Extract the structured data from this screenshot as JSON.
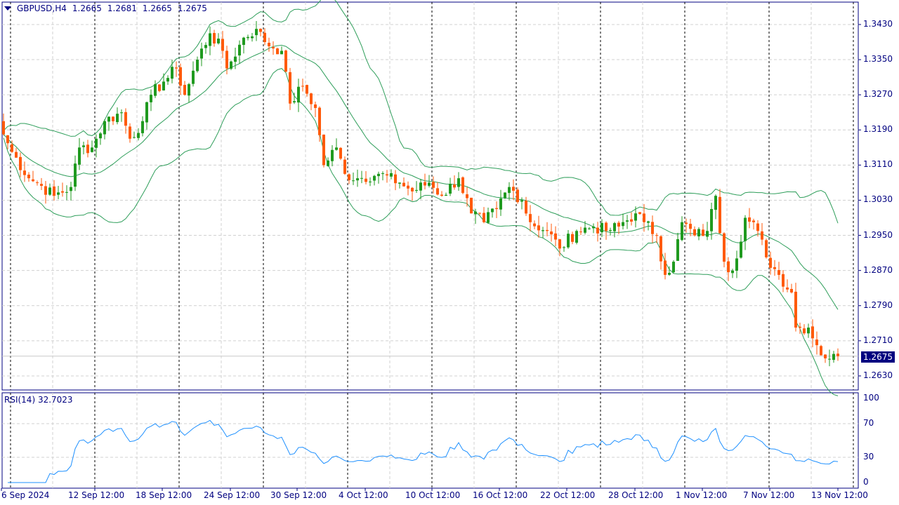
{
  "header": {
    "symbol": "GBPUSD,H4",
    "open": "1.2665",
    "high": "1.2681",
    "low": "1.2665",
    "close": "1.2675"
  },
  "current_price": "1.2675",
  "rsi": {
    "label": "RSI(14) 32.7023",
    "levels": [
      "100",
      "70",
      "30",
      "0"
    ]
  },
  "colors": {
    "bull": "#1f9a1f",
    "bear": "#ff5a0a",
    "band": "#2e9e5a",
    "rsi": "#1e90ff",
    "axis": "#000080",
    "grid": "#d0d0d0"
  },
  "chart_data": {
    "type": "candlestick",
    "title": "GBPUSD,H4",
    "price_ticks": [
      "1.3430",
      "1.3350",
      "1.3270",
      "1.3190",
      "1.3110",
      "1.3030",
      "1.2950",
      "1.2870",
      "1.2790",
      "1.2710",
      "1.2630"
    ],
    "ylim": [
      1.2598,
      1.3481
    ],
    "time_labels": [
      "6 Sep 2024",
      "12 Sep 12:00",
      "18 Sep 12:00",
      "24 Sep 12:00",
      "30 Sep 12:00",
      "4 Oct 12:00",
      "10 Oct 12:00",
      "16 Oct 12:00",
      "22 Oct 12:00",
      "28 Oct 12:00",
      "1 Nov 12:00",
      "7 Nov 12:00",
      "13 Nov 12:00"
    ],
    "bar_count": 199,
    "close_waypoints": [
      [
        0,
        1.318
      ],
      [
        2,
        1.314
      ],
      [
        6,
        1.308
      ],
      [
        8,
        1.307
      ],
      [
        12,
        1.304
      ],
      [
        16,
        1.306
      ],
      [
        18,
        1.315
      ],
      [
        21,
        1.315
      ],
      [
        24,
        1.321
      ],
      [
        28,
        1.323
      ],
      [
        30,
        1.317
      ],
      [
        33,
        1.321
      ],
      [
        35,
        1.327
      ],
      [
        38,
        1.33
      ],
      [
        41,
        1.333
      ],
      [
        43,
        1.327
      ],
      [
        46,
        1.335
      ],
      [
        49,
        1.341
      ],
      [
        52,
        1.337
      ],
      [
        53,
        1.333
      ],
      [
        57,
        1.34
      ],
      [
        60,
        1.342
      ],
      [
        62,
        1.339
      ],
      [
        66,
        1.337
      ],
      [
        68,
        1.325
      ],
      [
        71,
        1.329
      ],
      [
        74,
        1.324
      ],
      [
        76,
        1.311
      ],
      [
        79,
        1.315
      ],
      [
        81,
        1.309
      ],
      [
        84,
        1.308
      ],
      [
        89,
        1.309
      ],
      [
        94,
        1.307
      ],
      [
        97,
        1.305
      ],
      [
        101,
        1.307
      ],
      [
        104,
        1.304
      ],
      [
        108,
        1.308
      ],
      [
        111,
        1.3
      ],
      [
        114,
        1.298
      ],
      [
        117,
        1.301
      ],
      [
        120,
        1.306
      ],
      [
        123,
        1.303
      ],
      [
        125,
        1.298
      ],
      [
        129,
        1.296
      ],
      [
        132,
        1.292
      ],
      [
        136,
        1.296
      ],
      [
        140,
        1.297
      ],
      [
        143,
        1.296
      ],
      [
        146,
        1.297
      ],
      [
        150,
        1.3
      ],
      [
        152,
        1.298
      ],
      [
        155,
        1.295
      ],
      [
        157,
        1.286
      ],
      [
        159,
        1.289
      ],
      [
        161,
        1.298
      ],
      [
        164,
        1.295
      ],
      [
        167,
        1.296
      ],
      [
        169,
        1.304
      ],
      [
        171,
        1.289
      ],
      [
        173,
        1.287
      ],
      [
        176,
        1.299
      ],
      [
        179,
        1.296
      ],
      [
        181,
        1.29
      ],
      [
        184,
        1.286
      ],
      [
        187,
        1.282
      ],
      [
        188,
        1.274
      ],
      [
        191,
        1.274
      ],
      [
        193,
        1.27
      ],
      [
        195,
        1.267
      ],
      [
        197,
        1.268
      ],
      [
        198,
        1.2675
      ]
    ],
    "indicators": [
      "Bollinger Bands (20, 2)",
      "RSI(14)"
    ],
    "rsi_ylim": [
      0,
      100
    ]
  }
}
